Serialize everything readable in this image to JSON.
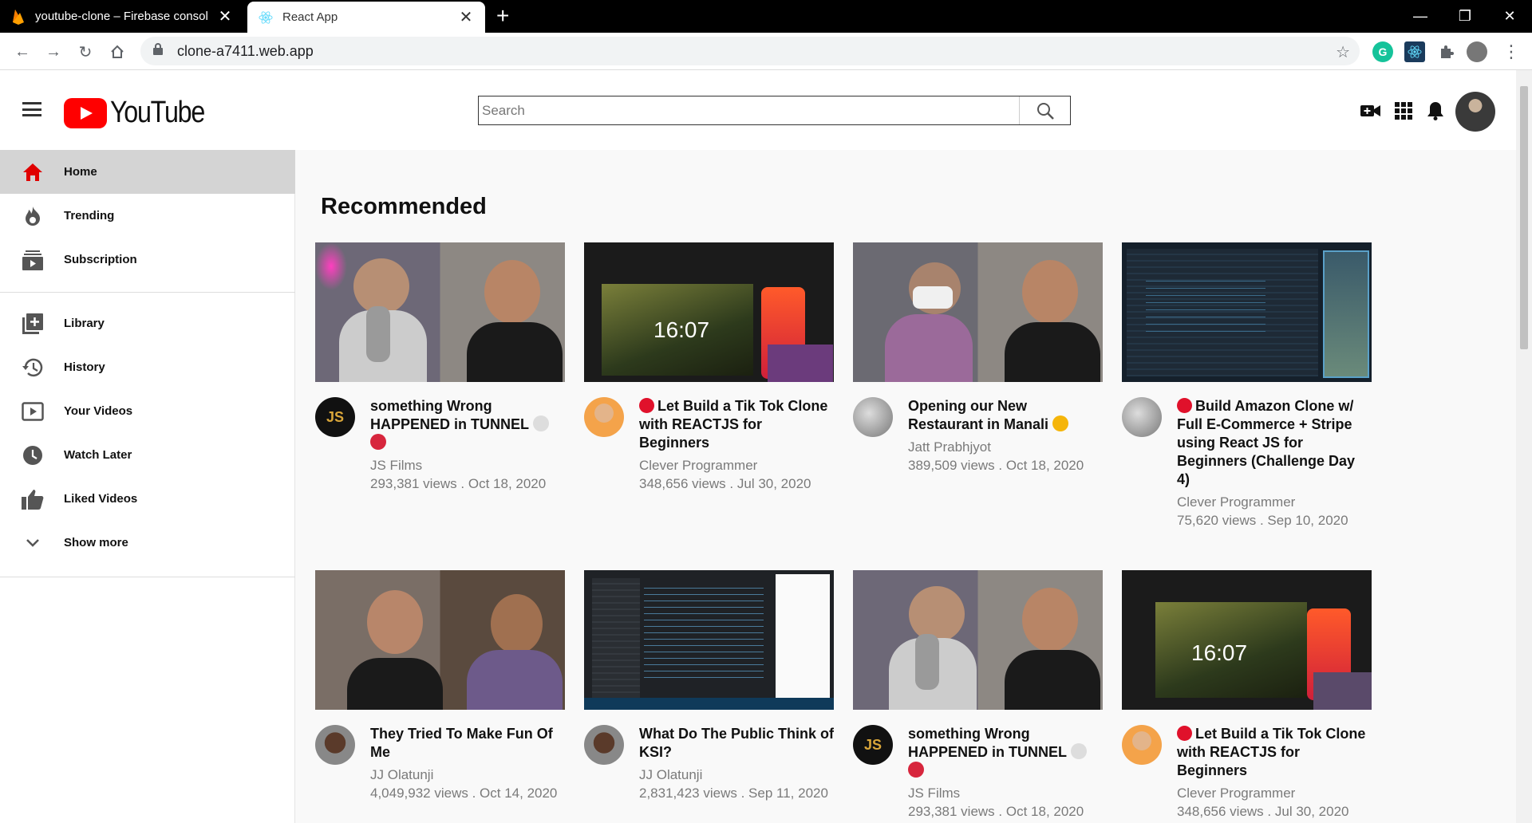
{
  "browser": {
    "tabs": [
      {
        "title": "youtube-clone – Firebase consol",
        "active": false
      },
      {
        "title": "React App",
        "active": true
      }
    ],
    "url": "clone-a7411.web.app"
  },
  "header": {
    "logo_text": "YouTube",
    "search_placeholder": "Search"
  },
  "sidebar": {
    "items": [
      {
        "label": "Home",
        "icon": "home-icon",
        "selected": true
      },
      {
        "label": "Trending",
        "icon": "trending-icon"
      },
      {
        "label": "Subscription",
        "icon": "subscription-icon"
      },
      {
        "label": "Library",
        "icon": "library-icon"
      },
      {
        "label": "History",
        "icon": "history-icon"
      },
      {
        "label": "Your Videos",
        "icon": "your-videos-icon"
      },
      {
        "label": "Watch Later",
        "icon": "watch-later-icon"
      },
      {
        "label": "Liked Videos",
        "icon": "liked-videos-icon"
      },
      {
        "label": "Show more",
        "icon": "chevron-down-icon"
      }
    ]
  },
  "main": {
    "title": "Recommended",
    "videos": [
      {
        "title": "something Wrong HAPPENED in TUNNEL",
        "channel": "JS Films",
        "views": "293,381 views",
        "date": "Oct 18, 2020"
      },
      {
        "title": "Let Build a Tik Tok Clone with REACTJS for Beginners",
        "channel": "Clever Programmer",
        "views": "348,656 views",
        "date": "Jul 30, 2020"
      },
      {
        "title": "Opening our New Restaurant in Manali",
        "channel": "Jatt Prabhjyot",
        "views": "389,509 views",
        "date": "Oct 18, 2020"
      },
      {
        "title": "Build Amazon Clone w/ Full E-Commerce + Stripe using React JS for Beginners (Challenge Day 4)",
        "channel": "Clever Programmer",
        "views": "75,620 views",
        "date": "Sep 10, 2020"
      },
      {
        "title": "They Tried To Make Fun Of Me",
        "channel": "JJ Olatunji",
        "views": "4,049,932 views",
        "date": "Oct 14, 2020"
      },
      {
        "title": "What Do The Public Think of KSI?",
        "channel": "JJ Olatunji",
        "views": "2,831,423 views",
        "date": "Sep 11, 2020"
      },
      {
        "title": "something Wrong HAPPENED in TUNNEL",
        "channel": "JS Films",
        "views": "293,381 views",
        "date": "Oct 18, 2020"
      },
      {
        "title": "Let Build a Tik Tok Clone with REACTJS for Beginners",
        "channel": "Clever Programmer",
        "views": "348,656 views",
        "date": "Jul 30, 2020"
      }
    ],
    "stat_separator": " . ",
    "thumb_clock": "16:07",
    "js_logo": "JS"
  },
  "colors": {
    "brand_red": "#ff0000",
    "selected_bg": "#d4d4d4",
    "meta_gray": "#7a7a7a"
  }
}
